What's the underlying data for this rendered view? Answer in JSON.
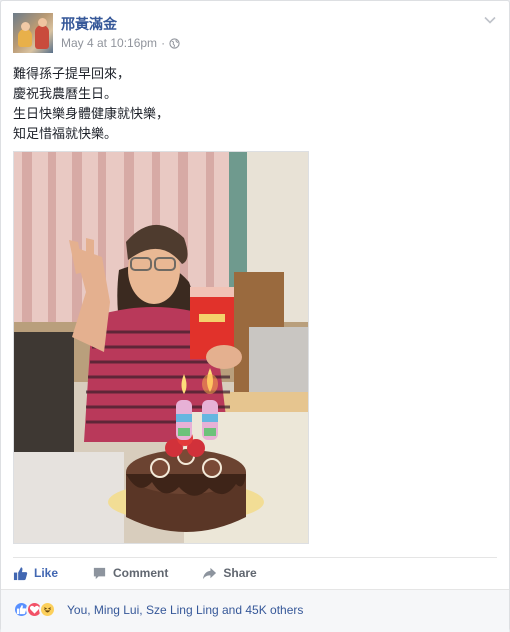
{
  "post": {
    "author": "邢黃滿金",
    "timestamp": "May 4 at 10:16pm",
    "separator": "·",
    "privacy_icon": "globe-icon",
    "text_lines": [
      "難得孫子提早回來，",
      "慶祝我農曆生日。",
      "生日快樂身體健康就快樂，",
      "知足惜福就快樂。"
    ],
    "photo_subject": "woman-with-birthday-cake"
  },
  "actions": {
    "like_label": "Like",
    "comment_label": "Comment",
    "share_label": "Share"
  },
  "reactions": {
    "icons": [
      "like-reaction-icon",
      "love-reaction-icon",
      "haha-reaction-icon"
    ],
    "summary": "You, Ming Lui, Sze Ling Ling and 45K others"
  },
  "colors": {
    "link_blue": "#365899",
    "like_blue": "#4267b2",
    "meta_gray": "#90949c",
    "love_red": "#f25268",
    "haha_yellow": "#fcd05c"
  }
}
